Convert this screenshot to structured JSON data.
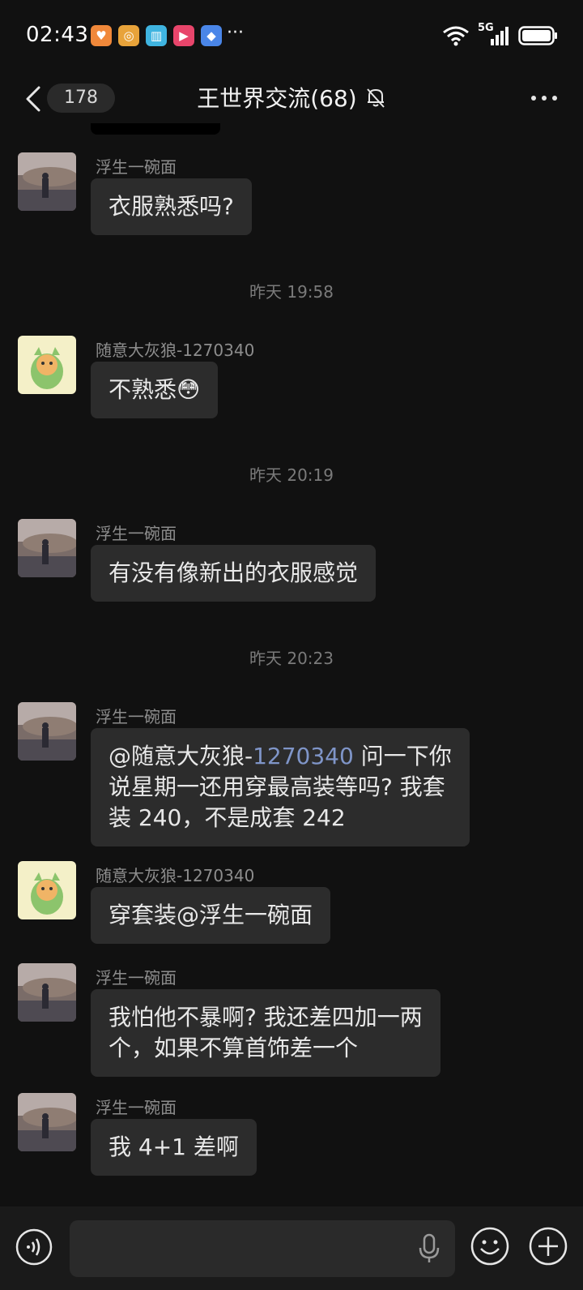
{
  "status_bar": {
    "time": "02:43",
    "more_indicator": "···",
    "network": "5G",
    "app_icons": [
      "heart-app-icon",
      "compass-app-icon",
      "book-app-icon",
      "play-app-icon",
      "shield-app-icon"
    ]
  },
  "header": {
    "unread_count": "178",
    "title": "王世界交流(68)",
    "muted": true
  },
  "messages": [
    {
      "sender": "浮生一碗面",
      "text": "衣服熟悉吗?",
      "avatar": "photo"
    },
    {
      "timestamp": "昨天 19:58"
    },
    {
      "sender": "随意大灰狼-1270340",
      "text": "不熟悉",
      "emoji": "😳",
      "avatar": "cartoon"
    },
    {
      "timestamp": "昨天 20:19"
    },
    {
      "sender": "浮生一碗面",
      "text": "有没有像新出的衣服感觉",
      "avatar": "photo"
    },
    {
      "timestamp": "昨天 20:23"
    },
    {
      "sender": "浮生一碗面",
      "text_prefix": "@随意大灰狼-",
      "text_mention_id": "1270340",
      "text_line1_rest": " 问一下你",
      "text_line2": "说星期一还用穿最高装等吗? 我套",
      "text_line3": "装 240，不是成套 242",
      "avatar": "photo"
    },
    {
      "sender": "随意大灰狼-1270340",
      "text": "穿套装@浮生一碗面",
      "avatar": "cartoon"
    },
    {
      "sender": "浮生一碗面",
      "text_line1": "我怕他不暴啊? 我还差四加一两",
      "text_line2": "个，如果不算首饰差一个",
      "avatar": "photo"
    },
    {
      "sender": "浮生一碗面",
      "text": "我 4+1 差啊",
      "avatar": "photo"
    }
  ],
  "input_bar": {
    "voice_icon": "voice-icon",
    "mic_icon": "mic-icon",
    "emoji_icon": "emoji-icon",
    "plus_icon": "plus-icon"
  },
  "colors": {
    "background": "#111111",
    "bubble": "#2c2c2c",
    "mention": "#7f95c8",
    "sender": "#8d8d8d"
  }
}
